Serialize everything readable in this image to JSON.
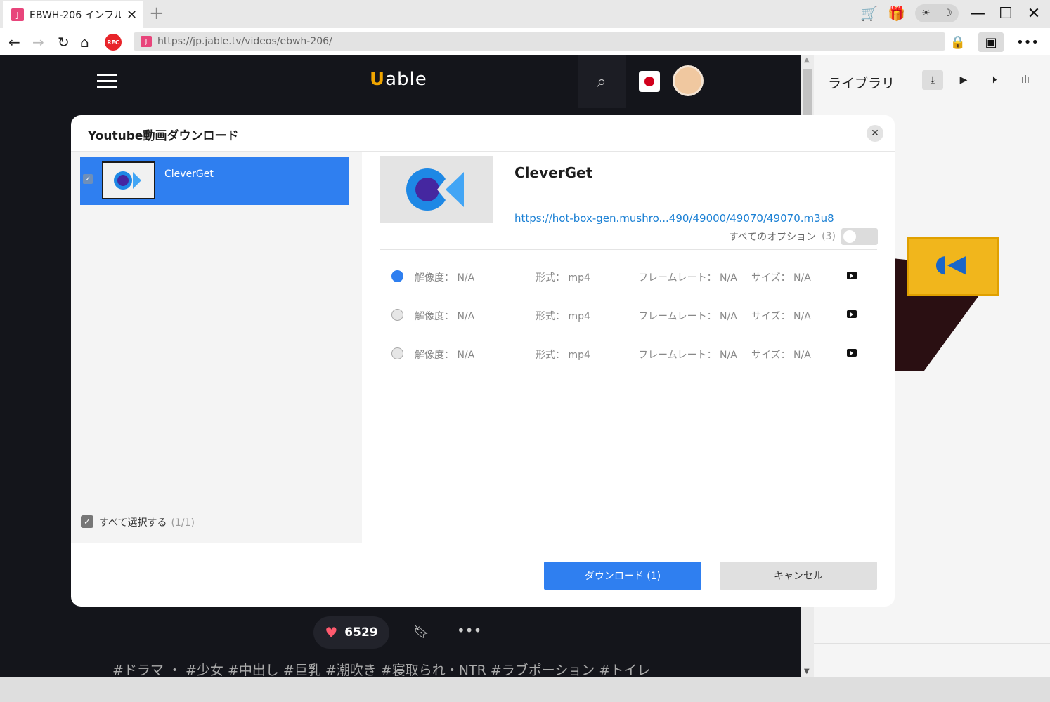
{
  "browser": {
    "tab_title": "EBWH-206 インフル:",
    "tab_favicon": "J",
    "url": "https://jp.jable.tv/videos/ebwh-206/",
    "rec_label": "REC"
  },
  "site": {
    "logo_text": "able",
    "likes": "6529",
    "tags": "#ドラマ ・ #少女 #中出し #巨乳 #潮吹き #寝取られ・NTR #ラブポーション #トイレ"
  },
  "library": {
    "title": "ライブラリ"
  },
  "modal": {
    "title": "Youtube動画ダウンロード",
    "list": [
      {
        "name": "CleverGet",
        "checked": true
      }
    ],
    "select_all_label": "すべて選択する",
    "select_all_count": "(1/1)",
    "video_name": "CleverGet",
    "video_url": "https://hot-box-gen.mushro...490/49000/49070/49070.m3u8",
    "options_label": "すべてのオプション",
    "options_count": "(3)",
    "rows": [
      {
        "res": "解像度： N/A",
        "fmt": "形式： mp4",
        "fps": "フレームレート： N/A",
        "size": "サイズ： N/A",
        "selected": true
      },
      {
        "res": "解像度： N/A",
        "fmt": "形式： mp4",
        "fps": "フレームレート： N/A",
        "size": "サイズ： N/A",
        "selected": false
      },
      {
        "res": "解像度： N/A",
        "fmt": "形式： mp4",
        "fps": "フレームレート： N/A",
        "size": "サイズ： N/A",
        "selected": false
      }
    ],
    "download_label": "ダウンロード (1)",
    "cancel_label": "キャンセル"
  },
  "colors": {
    "accent": "#2f7ff0",
    "link": "#1b80d4"
  }
}
